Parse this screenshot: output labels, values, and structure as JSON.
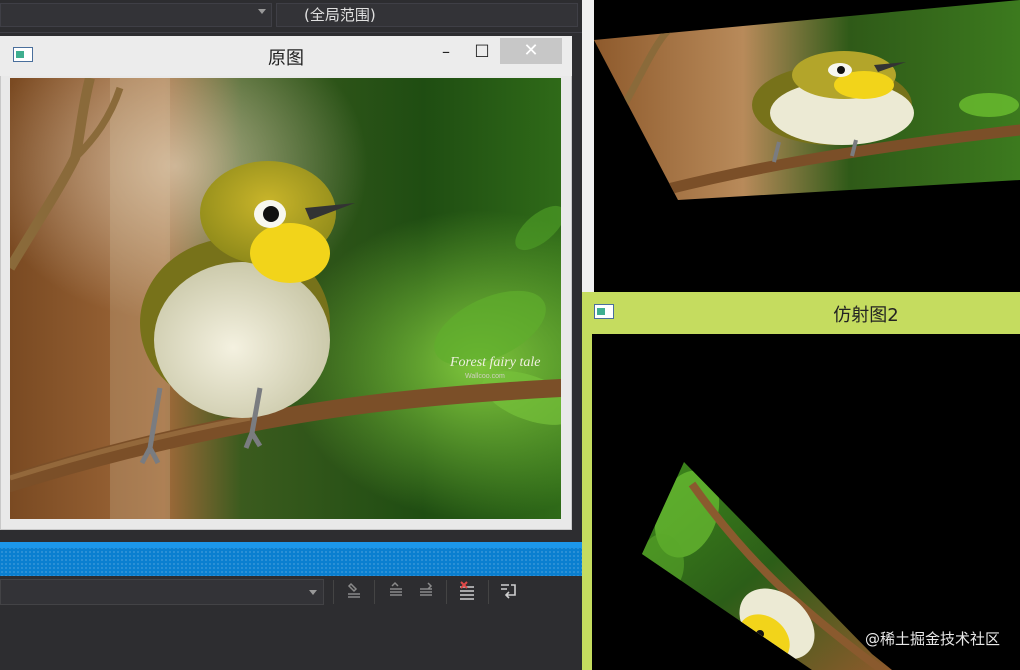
{
  "ide": {
    "scope_label": "(全局范围)"
  },
  "windows": [
    {
      "title": "原图",
      "controls": {
        "minimize": "–",
        "maximize": "□",
        "close": "✕"
      }
    },
    {
      "title": "仿射图2"
    }
  ],
  "photo": {
    "caption_line1": "Forest fairy tale",
    "caption_line2": "Wallcoo.com"
  },
  "watermark": "@稀土掘金技术社区",
  "colors": {
    "ide_bg": "#2d2d30",
    "status_blue": "#0a7fd0",
    "window3_frame": "#c5dc5f",
    "window1_chrome": "#ececec"
  },
  "icons": [
    "app-window-icon",
    "minimize-icon",
    "maximize-icon",
    "close-icon",
    "dropdown-arrow-icon"
  ]
}
